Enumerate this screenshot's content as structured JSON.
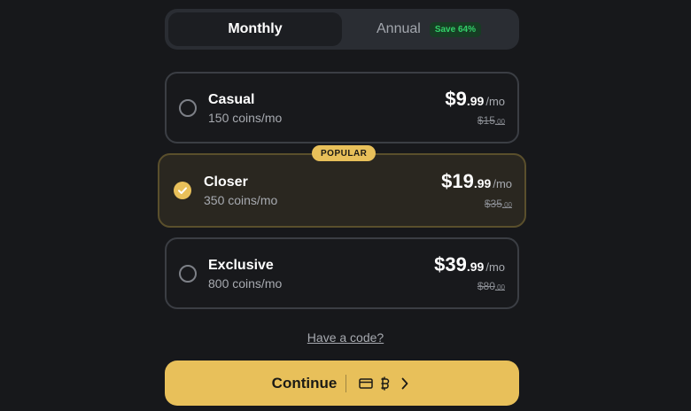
{
  "billing": {
    "monthly_label": "Monthly",
    "annual_label": "Annual",
    "annual_badge": "Save 64%"
  },
  "plans": [
    {
      "name": "Casual",
      "coins": "150 coins/mo",
      "price_whole": "$9",
      "price_cents": ".99",
      "per": "/mo",
      "old_whole": "$15",
      "old_cents": ".00",
      "selected": false
    },
    {
      "name": "Closer",
      "coins": "350 coins/mo",
      "price_whole": "$19",
      "price_cents": ".99",
      "per": "/mo",
      "old_whole": "$35",
      "old_cents": ".00",
      "selected": true,
      "badge": "POPULAR"
    },
    {
      "name": "Exclusive",
      "coins": "800 coins/mo",
      "price_whole": "$39",
      "price_cents": ".99",
      "per": "/mo",
      "old_whole": "$80",
      "old_cents": ".00",
      "selected": false
    }
  ],
  "code_link": "Have a code?",
  "continue": {
    "label": "Continue",
    "icons": [
      "credit-card-icon",
      "bitcoin-icon",
      "chevron-right-icon"
    ]
  },
  "colors": {
    "accent": "#e8c05a",
    "background": "#17181b",
    "save_green": "#33d16a"
  }
}
